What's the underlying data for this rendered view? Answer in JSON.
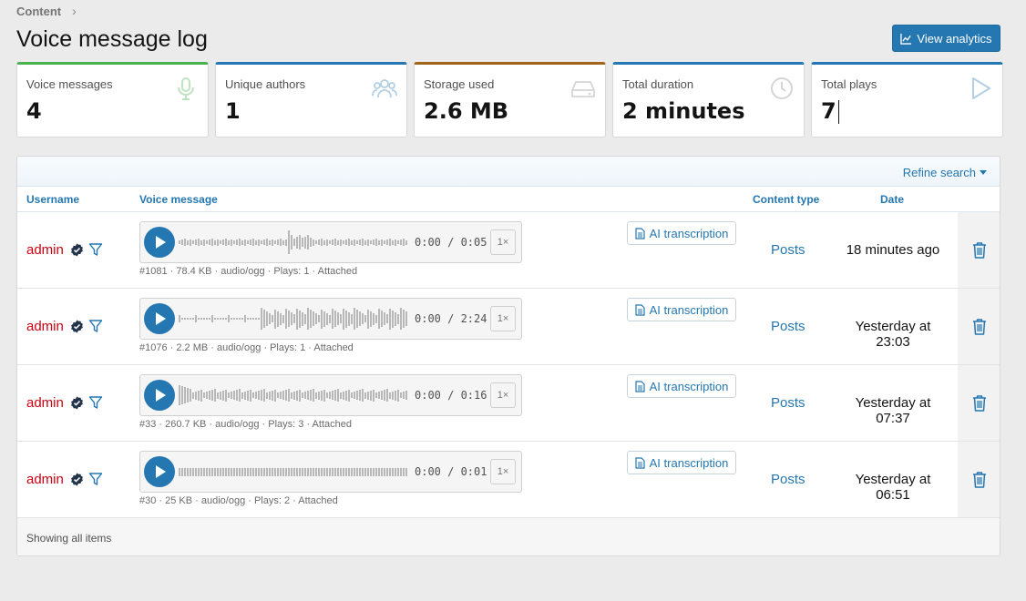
{
  "breadcrumb": {
    "label": "Content"
  },
  "page": {
    "title": "Voice message log"
  },
  "header": {
    "analytics_label": "View analytics"
  },
  "stats": [
    {
      "label": "Voice messages",
      "value": "4",
      "icon": "microphone-icon",
      "color": "#4bb04f"
    },
    {
      "label": "Unique authors",
      "value": "1",
      "icon": "users-icon",
      "color": "#2577b1"
    },
    {
      "label": "Storage used",
      "value": "2.6 MB",
      "icon": "hard-drive-icon",
      "color": "#a0651b"
    },
    {
      "label": "Total duration",
      "value": "2 minutes",
      "icon": "clock-icon",
      "color": "#2577b1"
    },
    {
      "label": "Total plays",
      "value": "7",
      "icon": "play-icon",
      "color": "#2577b1"
    }
  ],
  "filter": {
    "refine_label": "Refine search"
  },
  "table": {
    "headers": {
      "username": "Username",
      "voice_message": "Voice message",
      "content_type": "Content type",
      "date": "Date"
    },
    "ai_label": "AI transcription",
    "rows": [
      {
        "username": "admin",
        "time": "0:00 / 0:05",
        "speed": "1×",
        "meta": "#1081 · 78.4 KB · audio/ogg · Plays: 1 · Attached",
        "content_type": "Posts",
        "date": "18 minutes ago"
      },
      {
        "username": "admin",
        "time": "0:00 / 2:24",
        "speed": "1×",
        "meta": "#1076 · 2.2 MB · audio/ogg · Plays: 1 · Attached",
        "content_type": "Posts",
        "date": "Yesterday at 23:03"
      },
      {
        "username": "admin",
        "time": "0:00 / 0:16",
        "speed": "1×",
        "meta": "#33 · 260.7 KB · audio/ogg · Plays: 3 · Attached",
        "content_type": "Posts",
        "date": "Yesterday at 07:37"
      },
      {
        "username": "admin",
        "time": "0:00 / 0:01",
        "speed": "1×",
        "meta": "#30 · 25 KB · audio/ogg · Plays: 2 · Attached",
        "content_type": "Posts",
        "date": "Yesterday at 06:51"
      }
    ],
    "footer": "Showing all items"
  }
}
